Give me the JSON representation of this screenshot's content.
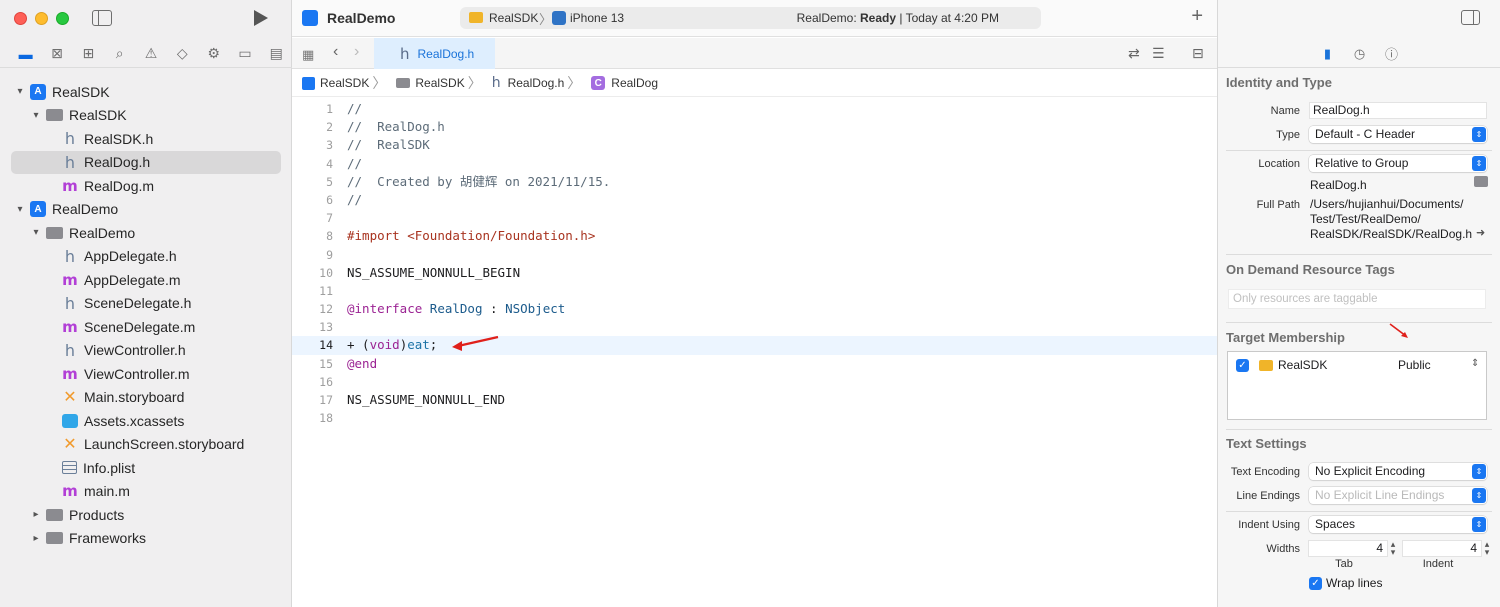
{
  "navigator": {
    "tree": [
      {
        "label": "RealSDK",
        "icon": "app-icon",
        "depth": 0,
        "disclosure": "▾"
      },
      {
        "label": "RealSDK",
        "icon": "folder-icon",
        "depth": 1,
        "disclosure": "▾"
      },
      {
        "label": "RealSDK.h",
        "icon": "header-file-icon",
        "depth": 2,
        "disclosure": ""
      },
      {
        "label": "RealDog.h",
        "icon": "header-file-icon",
        "depth": 2,
        "disclosure": "",
        "selected": true
      },
      {
        "label": "RealDog.m",
        "icon": "implementation-file-icon",
        "depth": 2,
        "disclosure": ""
      },
      {
        "label": "RealDemo",
        "icon": "app-icon",
        "depth": 0,
        "disclosure": "▾"
      },
      {
        "label": "RealDemo",
        "icon": "folder-icon",
        "depth": 1,
        "disclosure": "▾"
      },
      {
        "label": "AppDelegate.h",
        "icon": "header-file-icon",
        "depth": 2,
        "disclosure": ""
      },
      {
        "label": "AppDelegate.m",
        "icon": "implementation-file-icon",
        "depth": 2,
        "disclosure": ""
      },
      {
        "label": "SceneDelegate.h",
        "icon": "header-file-icon",
        "depth": 2,
        "disclosure": ""
      },
      {
        "label": "SceneDelegate.m",
        "icon": "implementation-file-icon",
        "depth": 2,
        "disclosure": ""
      },
      {
        "label": "ViewController.h",
        "icon": "header-file-icon",
        "depth": 2,
        "disclosure": ""
      },
      {
        "label": "ViewController.m",
        "icon": "implementation-file-icon",
        "depth": 2,
        "disclosure": ""
      },
      {
        "label": "Main.storyboard",
        "icon": "storyboard-icon",
        "depth": 2,
        "disclosure": ""
      },
      {
        "label": "Assets.xcassets",
        "icon": "assets-icon",
        "depth": 2,
        "disclosure": ""
      },
      {
        "label": "LaunchScreen.storyboard",
        "icon": "storyboard-icon",
        "depth": 2,
        "disclosure": ""
      },
      {
        "label": "Info.plist",
        "icon": "plist-icon",
        "depth": 2,
        "disclosure": ""
      },
      {
        "label": "main.m",
        "icon": "implementation-file-icon",
        "depth": 2,
        "disclosure": ""
      },
      {
        "label": "Products",
        "icon": "folder-icon",
        "depth": 1,
        "disclosure": "▸"
      },
      {
        "label": "Frameworks",
        "icon": "folder-icon",
        "depth": 1,
        "disclosure": "▸"
      }
    ]
  },
  "toolbar": {
    "project_title": "RealDemo",
    "scheme": "RealSDK",
    "device": "iPhone 13",
    "status_project": "RealDemo: ",
    "status_state": "Ready",
    "status_time": " | Today at 4:20 PM"
  },
  "tab": {
    "label": "RealDog.h"
  },
  "jumpbar": {
    "segments": [
      "RealSDK",
      "RealSDK",
      "RealDog.h",
      "RealDog"
    ]
  },
  "code": {
    "current_line": 14,
    "lines": [
      {
        "n": "1",
        "text": "//"
      },
      {
        "n": "2",
        "text": "//  RealDog.h"
      },
      {
        "n": "3",
        "text": "//  RealSDK"
      },
      {
        "n": "4",
        "text": "//"
      },
      {
        "n": "5",
        "text": "//  Created by 胡健辉 on 2021/11/15."
      },
      {
        "n": "6",
        "text": "//"
      },
      {
        "n": "7",
        "text": ""
      },
      {
        "n": "8",
        "text": "#import <Foundation/Foundation.h>"
      },
      {
        "n": "9",
        "text": ""
      },
      {
        "n": "10",
        "text": "NS_ASSUME_NONNULL_BEGIN"
      },
      {
        "n": "11",
        "text": ""
      },
      {
        "n": "12",
        "text": "@interface RealDog : NSObject"
      },
      {
        "n": "13",
        "text": ""
      },
      {
        "n": "14",
        "text": "+ (void)eat;"
      },
      {
        "n": "15",
        "text": "@end"
      },
      {
        "n": "16",
        "text": ""
      },
      {
        "n": "17",
        "text": "NS_ASSUME_NONNULL_END"
      },
      {
        "n": "18",
        "text": ""
      }
    ]
  },
  "inspector": {
    "identity_title": "Identity and Type",
    "name_label": "Name",
    "name_value": "RealDog.h",
    "type_label": "Type",
    "type_value": "Default - C Header",
    "location_label": "Location",
    "location_value": "Relative to Group",
    "location_file": "RealDog.h",
    "fullpath_label": "Full Path",
    "fullpath_line1": "/Users/hujianhui/Documents/",
    "fullpath_line2": "Test/Test/RealDemo/",
    "fullpath_line3": "RealSDK/RealSDK/RealDog.h",
    "tags_title": "On Demand Resource Tags",
    "tags_placeholder": "Only resources are taggable",
    "membership_title": "Target Membership",
    "membership_target": "RealSDK",
    "membership_visibility": "Public",
    "text_settings_title": "Text Settings",
    "encoding_label": "Text Encoding",
    "encoding_value": "No Explicit Encoding",
    "line_endings_label": "Line Endings",
    "line_endings_value": "No Explicit Line Endings",
    "indent_using_label": "Indent Using",
    "indent_using_value": "Spaces",
    "widths_label": "Widths",
    "tab_width": "4",
    "indent_width": "4",
    "tab_caption": "Tab",
    "indent_caption": "Indent",
    "wrap_label": "Wrap lines"
  },
  "colors": {
    "accent": "#1a77f2",
    "annotation_arrow": "#e0201b",
    "current_line_bg": "#ecf5ff"
  }
}
